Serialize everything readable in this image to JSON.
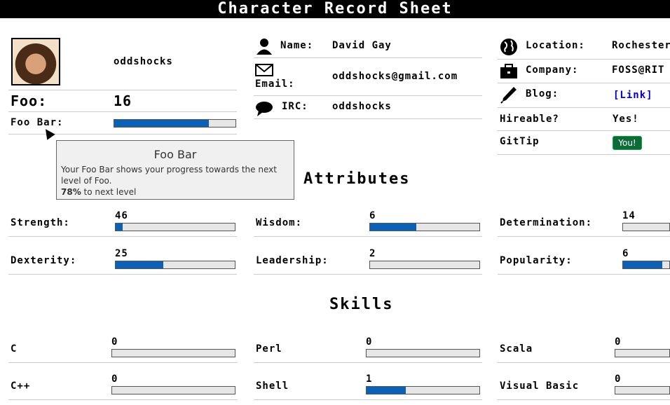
{
  "title": "Character Record Sheet",
  "profile": {
    "username": "oddshocks",
    "foo_label": "Foo:",
    "foo_value": "16",
    "foobar_label": "Foo Bar:",
    "foobar_progress": 0.78
  },
  "info": {
    "name_label": "Name:",
    "name_value": "David Gay",
    "email_label": "Email:",
    "email_value": "oddshocks@gmail.com",
    "irc_label": "IRC:",
    "irc_value": "oddshocks",
    "location_label": "Location:",
    "location_value": "Rochester",
    "company_label": "Company:",
    "company_value": "FOSS@RIT",
    "blog_label": "Blog:",
    "blog_value": "[Link]",
    "hireable_label": "Hireable?",
    "hireable_value": "Yes!",
    "gittip_label": "GitTip",
    "gittip_button": "You!"
  },
  "tooltip": {
    "title": "Foo Bar",
    "body": "Your Foo Bar shows your progress towards the next level of Foo.",
    "percent": "78%",
    "suffix": " to next level"
  },
  "sections": {
    "attributes": "Attributes",
    "skills": "Skills"
  },
  "attributes": [
    {
      "label": "Strength:",
      "value": "46",
      "progress": 0.06
    },
    {
      "label": "Wisdom:",
      "value": "6",
      "progress": 0.42
    },
    {
      "label": "Determination:",
      "value": "14",
      "progress": 0.0
    },
    {
      "label": "Dexterity:",
      "value": "25",
      "progress": 0.4
    },
    {
      "label": "Leadership:",
      "value": "2",
      "progress": 0.0
    },
    {
      "label": "Popularity:",
      "value": "6",
      "progress": 0.85
    }
  ],
  "skills": [
    {
      "label": "C",
      "value": "0",
      "progress": 0.0
    },
    {
      "label": "Perl",
      "value": "0",
      "progress": 0.0
    },
    {
      "label": "Scala",
      "value": "0",
      "progress": 0.0
    },
    {
      "label": "C++",
      "value": "0",
      "progress": 0.0
    },
    {
      "label": "Shell",
      "value": "1",
      "progress": 0.35
    },
    {
      "label": "Visual Basic",
      "value": "0",
      "progress": 0.0
    }
  ],
  "colors": {
    "bar_fill": "#0a62b8",
    "bar_bg": "#e6e6e6",
    "link": "#0000cc",
    "button_green": "#0f6a3a"
  }
}
